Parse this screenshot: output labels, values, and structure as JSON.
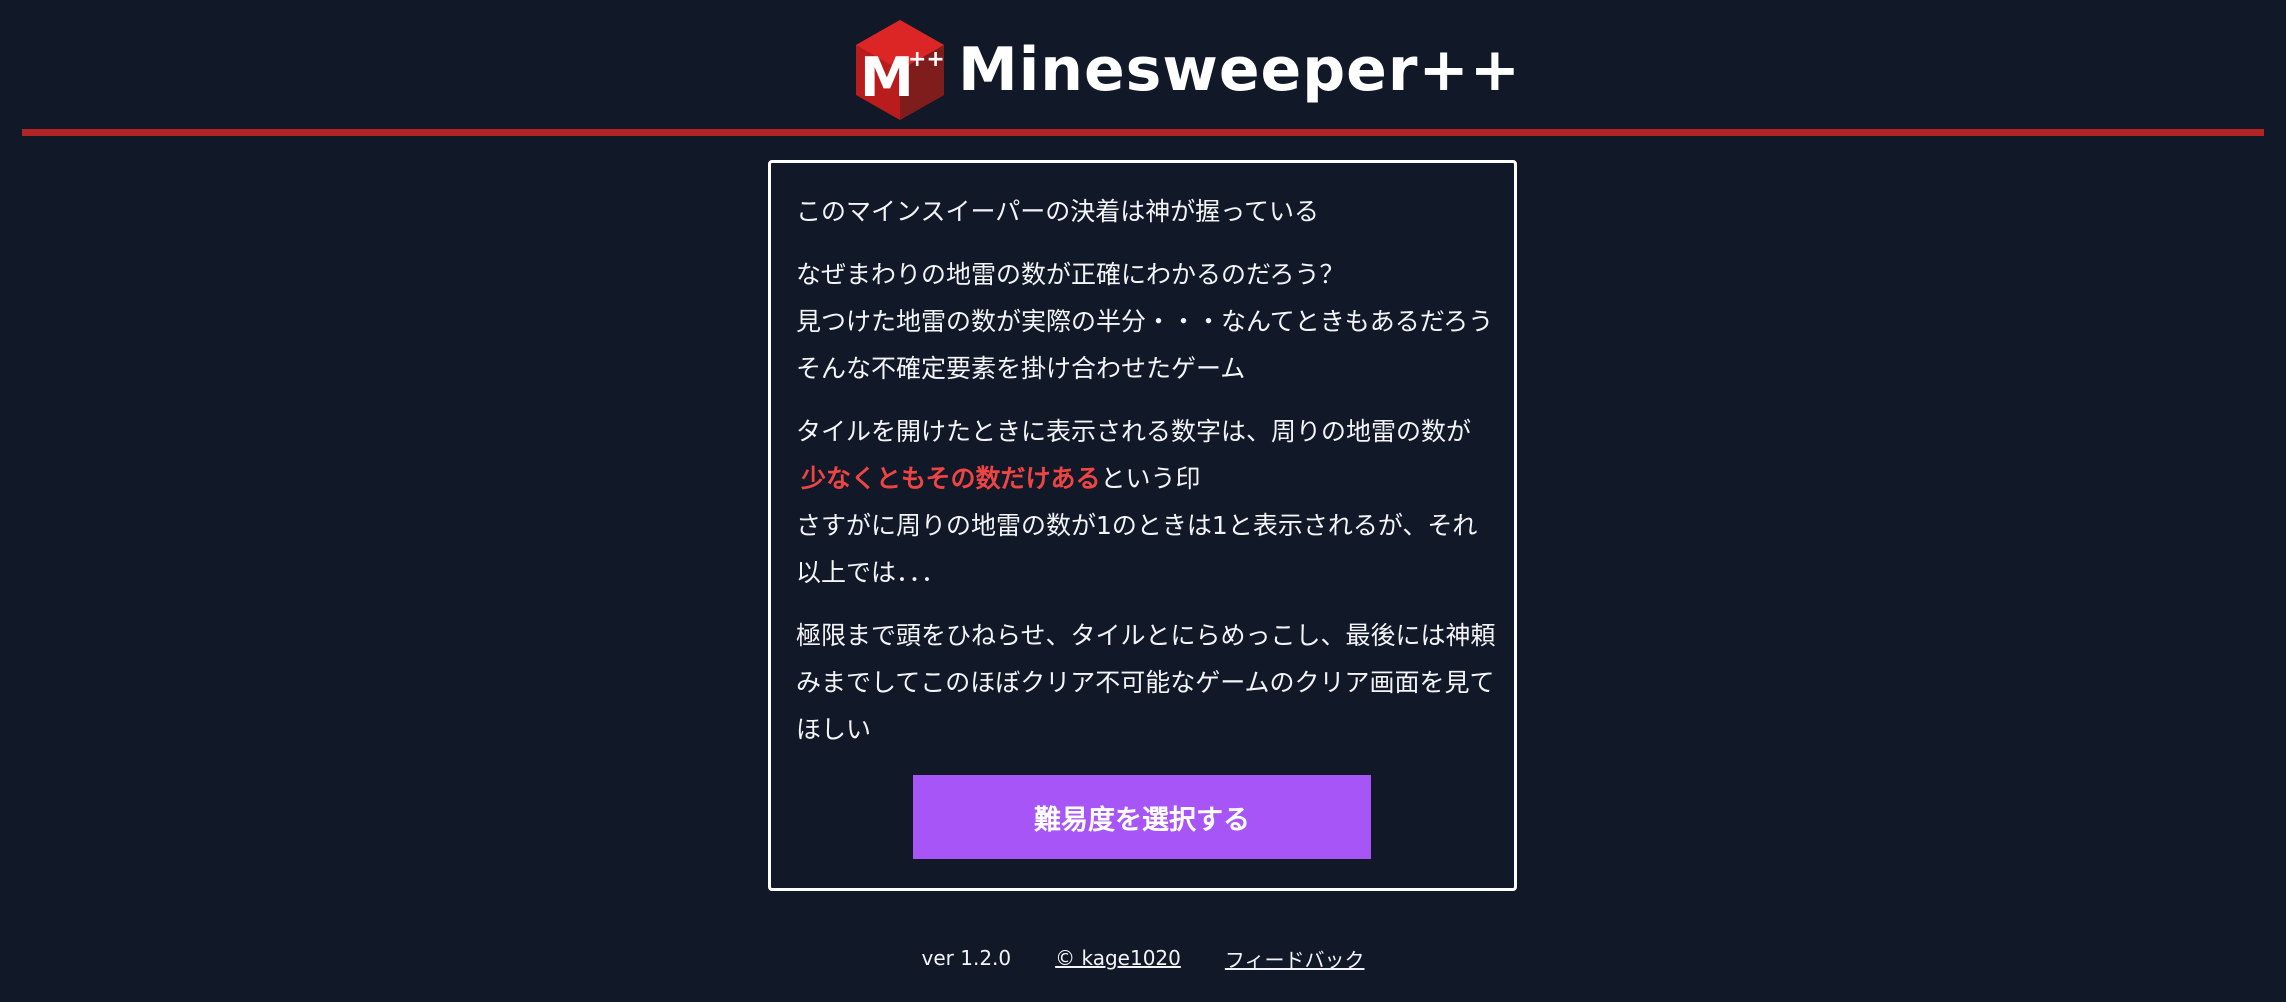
{
  "header": {
    "logo_icon": "minesweeper-plus-plus-logo-icon",
    "logo_letter": "M",
    "logo_badge": "++",
    "title": "Minesweeper++",
    "accent_color": "#b32525"
  },
  "card": {
    "headline": "このマインスイーパーの決着は神が握っている",
    "paragraph1": [
      "なぜまわりの地雷の数が正確にわかるのだろう？",
      "見つけた地雷の数が実際の半分・・・なんてときもあるだろう",
      "そんな不確定要素を掛け合わせたゲーム"
    ],
    "paragraph2": {
      "line1": "タイルを開けたときに表示される数字は、周りの地雷の数が",
      "highlight": "少なくともその数だけある",
      "line2_rest": "という印",
      "line3": "さすがに周りの地雷の数が1のときは1と表示されるが、それ以上では．．．"
    },
    "paragraph3": "極限まで頭をひねらせ、タイルとにらめっこし、最後には神頼みまでしてこのほぼクリア不可能なゲームのクリア画面を見てほしい",
    "button_label": "難易度を選択する",
    "button_color": "#a855f7",
    "highlight_color": "#ef4444"
  },
  "footer": {
    "version": "ver 1.2.0",
    "copyright": "© kage1020",
    "feedback": "フィードバック"
  }
}
